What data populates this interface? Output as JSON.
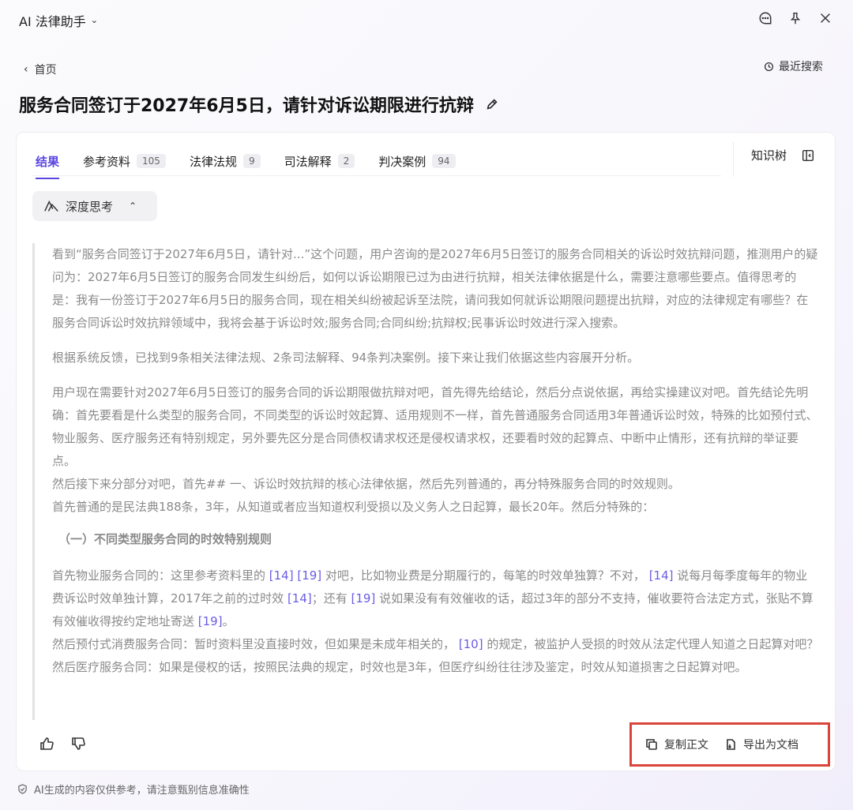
{
  "header": {
    "app_title": "AI 法律助手",
    "icons": [
      "chat-icon",
      "pin-icon",
      "close-icon"
    ]
  },
  "nav": {
    "back_label": "首页",
    "recent_label": "最近搜索"
  },
  "page": {
    "title": "服务合同签订于2027年6月5日，请针对诉讼期限进行抗辩"
  },
  "tabs": [
    {
      "label": "结果",
      "count": null,
      "active": true
    },
    {
      "label": "参考资料",
      "count": "105"
    },
    {
      "label": "法律法规",
      "count": "9"
    },
    {
      "label": "司法解释",
      "count": "2"
    },
    {
      "label": "判决案例",
      "count": "94"
    }
  ],
  "knowledge_tree_label": "知识树",
  "deep_think": {
    "label": "深度思考",
    "p1": "看到“服务合同签订于2027年6月5日，请针对...”这个问题，用户咨询的是2027年6月5日签订的服务合同相关的诉讼时效抗辩问题，推测用户的疑问为：2027年6月5日签订的服务合同发生纠纷后，如何以诉讼期限已过为由进行抗辩，相关法律依据是什么，需要注意哪些要点。值得思考的是：我有一份签订于2027年6月5日的服务合同，现在相关纠纷被起诉至法院，请问我如何就诉讼期限问题提出抗辩，对应的法律规定有哪些？在服务合同诉讼时效抗辩领域中，我将会基于诉讼时效;服务合同;合同纠纷;抗辩权;民事诉讼时效进行深入搜索。",
    "p2": "根据系统反馈，已找到9条相关法律法规、2条司法解释、94条判决案例。接下来让我们依据这些内容展开分析。",
    "p3": "用户现在需要针对2027年6月5日签订的服务合同的诉讼期限做抗辩对吧，首先得先给结论，然后分点说依据，再给实操建议对吧。首先结论先明确：首先要看是什么类型的服务合同，不同类型的诉讼时效起算、适用规则不一样，首先普通服务合同适用3年普通诉讼时效，特殊的比如预付式、物业服务、医疗服务还有特别规定，另外要先区分是合同债权请求权还是侵权请求权，还要看时效的起算点、中断中止情形，还有抗辩的举证要点。",
    "p4": "然后接下来分部分对吧，首先## 一、诉讼时效抗辩的核心法律依据，然后先列普通的，再分特殊服务合同的时效规则。",
    "p5": "首先普通的是民法典188条，3年，从知道或者应当知道权利受损以及义务人之日起算，最长20年。然后分特殊的：",
    "heading": "（一）不同类型服务合同的时效特别规则",
    "p6_a": "首先物业服务合同的：这里参考资料里的 ",
    "ref14": "[14]",
    "ref19": "[19]",
    "ref10": "[10]",
    "p6_b": " 对吧，比如物业费是分期履行的，每笔的时效单独算？不对， ",
    "p6_c": " 说每月每季度每年的物业费诉讼时效单独计算，2017年之前的过时效 ",
    "p6_d": "；还有 ",
    "p6_e": " 说如果没有有效催收的话，超过3年的部分不支持，催收要符合法定方式，张贴不算有效催收得按约定地址寄送 ",
    "p6_f": "。",
    "p7_a": "然后预付式消费服务合同：暂时资料里没直接时效，但如果是未成年相关的， ",
    "p7_b": " 的规定，被监护人受损的时效从法定代理人知道之日起算对吧？",
    "p8": "然后医疗服务合同：如果是侵权的话，按照民法典的规定，时效也是3年，但医疗纠纷往往涉及鉴定，时效从知道损害之日起算对吧。"
  },
  "footer_actions": {
    "copy_label": "复制正文",
    "export_label": "导出为文档"
  },
  "disclaimer": "AI生成的内容仅供参考，请注意甄别信息准确性",
  "colors": {
    "accent": "#5b47e0",
    "reference": "#6a5ce6",
    "highlight_border": "#d9453a"
  }
}
